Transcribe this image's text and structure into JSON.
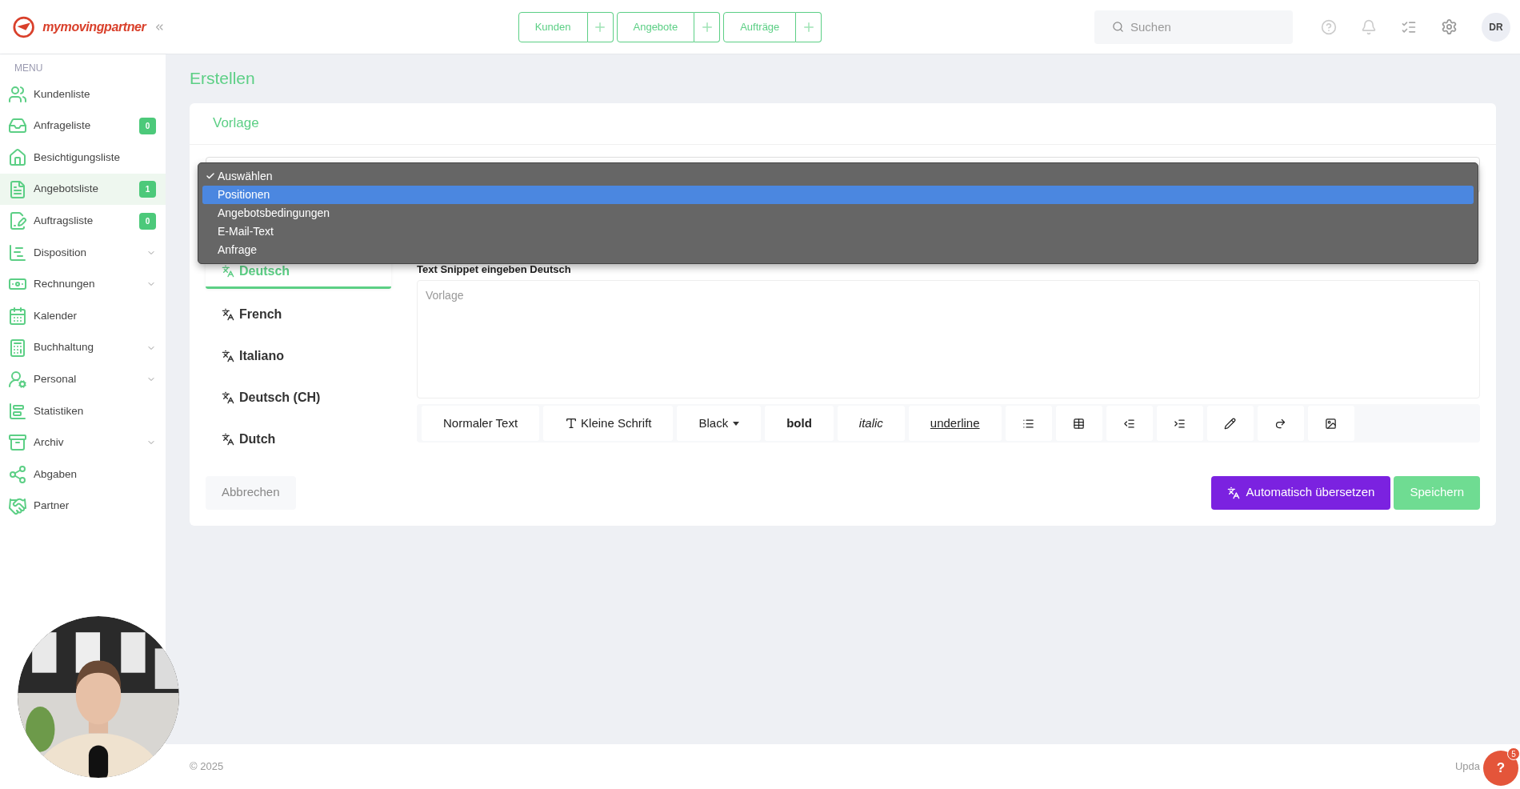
{
  "header": {
    "logo": "mymovingpartner",
    "quick_buttons": [
      {
        "label": "Kunden"
      },
      {
        "label": "Angebote"
      },
      {
        "label": "Aufträge"
      }
    ],
    "search": {
      "placeholder": "Suchen"
    },
    "avatar": "DR"
  },
  "sidebar": {
    "heading": "MENU",
    "items": [
      {
        "label": "Kundenliste",
        "selected": false,
        "expandable": false
      },
      {
        "label": "Anfrageliste",
        "selected": false,
        "expandable": false,
        "badge": "0"
      },
      {
        "label": "Besichtigungsliste",
        "selected": false,
        "expandable": false
      },
      {
        "label": "Angebotsliste",
        "selected": true,
        "expandable": false,
        "badge": "1"
      },
      {
        "label": "Auftragsliste",
        "selected": false,
        "expandable": false,
        "badge": "0"
      },
      {
        "label": "Disposition",
        "selected": false,
        "expandable": true
      },
      {
        "label": "Rechnungen",
        "selected": false,
        "expandable": true
      },
      {
        "label": "Kalender",
        "selected": false,
        "expandable": false
      },
      {
        "label": "Buchhaltung",
        "selected": false,
        "expandable": true
      },
      {
        "label": "Personal",
        "selected": false,
        "expandable": true
      },
      {
        "label": "Statistiken",
        "selected": false,
        "expandable": false
      },
      {
        "label": "Archiv",
        "selected": false,
        "expandable": true
      },
      {
        "label": "Abgaben",
        "selected": false,
        "expandable": false
      },
      {
        "label": "Partner",
        "selected": false,
        "expandable": false
      }
    ]
  },
  "page_title": "Erstellen",
  "card": {
    "title": "Vorlage",
    "dropdown": {
      "options": [
        {
          "label": "Auswählen",
          "selected": true,
          "highlighted": false
        },
        {
          "label": "Positionen",
          "selected": false,
          "highlighted": true
        },
        {
          "label": "Angebotsbedingungen",
          "selected": false,
          "highlighted": false
        },
        {
          "label": "E-Mail-Text",
          "selected": false,
          "highlighted": false
        },
        {
          "label": "Anfrage",
          "selected": false,
          "highlighted": false
        }
      ]
    },
    "languages": [
      {
        "label": "Deutsch",
        "selected": true
      },
      {
        "label": "French",
        "selected": false
      },
      {
        "label": "Italiano",
        "selected": false
      },
      {
        "label": "Deutsch (CH)",
        "selected": false
      },
      {
        "label": "Dutch",
        "selected": false
      }
    ],
    "editor_label": "Text Snippet eingeben Deutsch",
    "editor": {
      "placeholder": "Vorlage"
    },
    "toolbar": [
      {
        "kind": "plain",
        "label": "Normaler Text"
      },
      {
        "kind": "size",
        "label": "Kleine Schrift"
      },
      {
        "kind": "dropdown",
        "label": "Black"
      },
      {
        "kind": "bold",
        "label": "bold"
      },
      {
        "kind": "italic",
        "label": "italic"
      },
      {
        "kind": "underline",
        "label": "underline"
      }
    ],
    "cancel": "Abbrechen",
    "translate": "Automatisch übersetzen",
    "save": "Speichern"
  },
  "footer": {
    "copyright": "© 2025",
    "right": "Upda"
  },
  "help": {
    "label": "?",
    "badge": "5"
  }
}
